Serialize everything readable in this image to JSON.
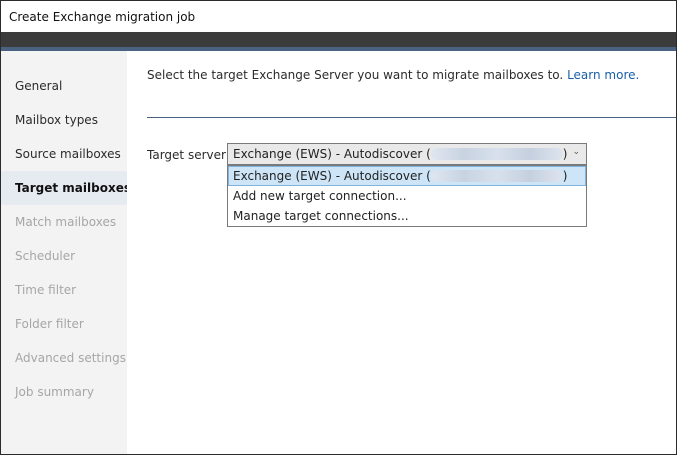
{
  "window": {
    "title": "Create Exchange migration job"
  },
  "sidebar": {
    "items": [
      {
        "label": "General",
        "state": "normal"
      },
      {
        "label": "Mailbox types",
        "state": "normal"
      },
      {
        "label": "Source mailboxes",
        "state": "normal"
      },
      {
        "label": "Target mailboxes",
        "state": "active"
      },
      {
        "label": "Match mailboxes",
        "state": "disabled"
      },
      {
        "label": "Scheduler",
        "state": "disabled"
      },
      {
        "label": "Time filter",
        "state": "disabled"
      },
      {
        "label": "Folder filter",
        "state": "disabled"
      },
      {
        "label": "Advanced settings",
        "state": "disabled"
      },
      {
        "label": "Job summary",
        "state": "disabled"
      }
    ]
  },
  "main": {
    "intro_text": "Select the target Exchange Server you want to migrate mailboxes to.",
    "learn_more": "Learn more.",
    "target_server_label": "Target server:",
    "combo": {
      "selected_prefix": "Exchange (EWS) - Autodiscover (",
      "selected_suffix": ")",
      "chevron_icon": "chevron-down-icon"
    },
    "dropdown_options": [
      {
        "prefix": "Exchange (EWS) - Autodiscover (",
        "suffix": ")",
        "selected": true,
        "redacted": true
      },
      {
        "prefix": "Add new target connection...",
        "suffix": "",
        "selected": false,
        "redacted": false
      },
      {
        "prefix": "Manage target connections...",
        "suffix": "",
        "selected": false,
        "redacted": false
      }
    ]
  },
  "colors": {
    "accent_line": "#4a6282",
    "link": "#1a5fa8",
    "selected_option": "#cde5f7",
    "active_nav": "#e6eaf1"
  }
}
